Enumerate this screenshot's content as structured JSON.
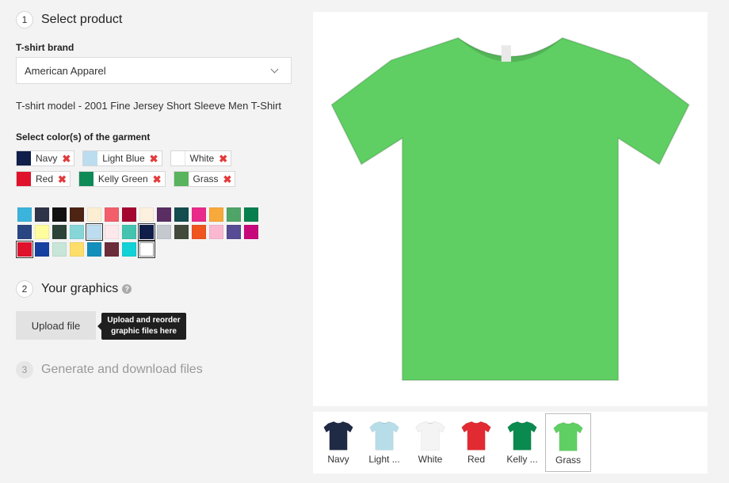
{
  "steps": [
    {
      "num": "1",
      "title": "Select product"
    },
    {
      "num": "2",
      "title": "Your graphics"
    },
    {
      "num": "3",
      "title": "Generate and download files"
    }
  ],
  "brand": {
    "label": "T-shirt brand",
    "value": "American Apparel"
  },
  "model_text": "T-shirt model - 2001 Fine Jersey Short Sleeve Men T-Shirt",
  "colors_label": "Select color(s) of the garment",
  "selected_colors": [
    {
      "name": "Navy",
      "color": "#0f1f4a"
    },
    {
      "name": "Light Blue",
      "color": "#bcdcef"
    },
    {
      "name": "White",
      "color": "#ffffff"
    },
    {
      "name": "Red",
      "color": "#e0112b"
    },
    {
      "name": "Kelly Green",
      "color": "#0e8a57"
    },
    {
      "name": "Grass",
      "color": "#57b35c"
    }
  ],
  "palette": [
    [
      "#3bb4dc",
      "#2f3448",
      "#111111",
      "#4d2414",
      "#fbeed2",
      "#f25f6a",
      "#a4052f",
      "#fcf1de",
      "#5a2d63",
      "#134d4f",
      "#ea2a8a",
      "#f8a93b",
      "#4fa567",
      "#087f4f"
    ],
    [
      "#2a4682",
      "#fefc9d",
      "#2d4238",
      "#86d6d8",
      "#bcdcef",
      "#fde8ec",
      "#44c3b1",
      "#0f1f4a",
      "#c3c9cf",
      "#424b3b",
      "#f0541f",
      "#f9b8d0",
      "#564b94",
      "#c7087b"
    ],
    [
      "#e0112b",
      "#1640a0",
      "#c8e6d8",
      "#fdde6a",
      "#128fbb",
      "#6b2d3a",
      "#12d2d8",
      "#ffffff"
    ]
  ],
  "upload_label": "Upload file",
  "tooltip": {
    "line1": "Upload and reorder",
    "line2": "graphic files here"
  },
  "help_icon": "?",
  "preview_color": "#5fcf63",
  "thumbnails": [
    {
      "label": "Navy",
      "color": "#1f2a44"
    },
    {
      "label": "Light ...",
      "color": "#b7dde8"
    },
    {
      "label": "White",
      "color": "#f4f4f4"
    },
    {
      "label": "Red",
      "color": "#e22a32"
    },
    {
      "label": "Kelly ...",
      "color": "#0a8a4e"
    },
    {
      "label": "Grass",
      "color": "#5fcf63"
    }
  ]
}
